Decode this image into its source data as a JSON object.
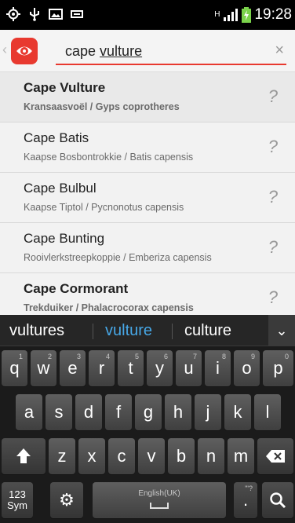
{
  "status_bar": {
    "time": "19:28",
    "network": "H"
  },
  "search": {
    "query_prefix": "cape ",
    "query_underlined": "vulture",
    "clear_symbol": "×"
  },
  "results": [
    {
      "name": "Cape Vulture",
      "subtitle": "Kransaasvoël / Gyps coprotheres",
      "bold": true
    },
    {
      "name": "Cape Batis",
      "subtitle": "Kaapse Bosbontrokkie / Batis capensis",
      "bold": false
    },
    {
      "name": "Cape Bulbul",
      "subtitle": "Kaapse Tiptol / Pycnonotus capensis",
      "bold": false
    },
    {
      "name": "Cape Bunting",
      "subtitle": "Rooivlerkstreepkoppie / Emberiza capensis",
      "bold": false
    },
    {
      "name": "Cape Cormorant",
      "subtitle": "Trekduiker / Phalacrocorax capensis",
      "bold": true
    }
  ],
  "keyboard": {
    "suggestions": [
      "vultures",
      "vulture",
      "culture"
    ],
    "selected_suggestion": "vulture",
    "row1": [
      {
        "k": "q",
        "sup": "1"
      },
      {
        "k": "w",
        "sup": "2"
      },
      {
        "k": "e",
        "sup": "3"
      },
      {
        "k": "r",
        "sup": "4"
      },
      {
        "k": "t",
        "sup": "5"
      },
      {
        "k": "y",
        "sup": "6"
      },
      {
        "k": "u",
        "sup": "7"
      },
      {
        "k": "i",
        "sup": "8"
      },
      {
        "k": "o",
        "sup": "9"
      },
      {
        "k": "p",
        "sup": "0"
      }
    ],
    "row2": [
      "a",
      "s",
      "d",
      "f",
      "g",
      "h",
      "j",
      "k",
      "l"
    ],
    "row3": [
      "z",
      "x",
      "c",
      "v",
      "b",
      "n",
      "m"
    ],
    "sym_label_1": "123",
    "sym_label_2": "Sym",
    "space_label": "English(UK)",
    "period_label": ".",
    "period_sup": "'\"?"
  },
  "colors": {
    "accent": "#e8392f",
    "suggestion_selected": "#47a7e6"
  }
}
